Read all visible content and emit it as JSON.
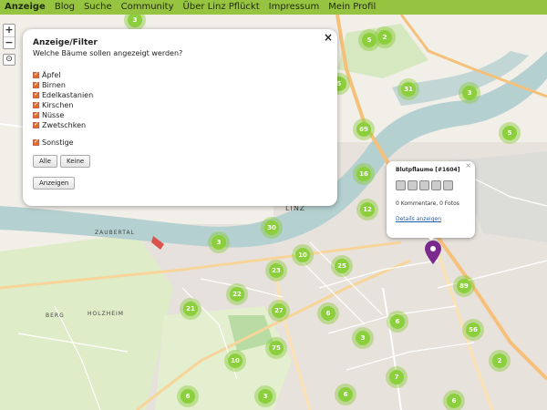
{
  "nav": {
    "items": [
      "Anzeige",
      "Blog",
      "Suche",
      "Community",
      "Über Linz Pflückt",
      "Impressum",
      "Mein Profil"
    ]
  },
  "map": {
    "labels": {
      "zaubertal": "ZAUBERTAL",
      "holzheim": "HOLZHEIM",
      "berg": "BERG",
      "linz": "LINZ"
    },
    "clusters": [
      "3",
      "5",
      "31",
      "69",
      "16",
      "12",
      "30",
      "3",
      "10",
      "25",
      "23",
      "22",
      "21",
      "27",
      "75",
      "10",
      "6",
      "6",
      "6",
      "3",
      "7",
      "3",
      "89",
      "56",
      "2",
      "6",
      "6",
      "2",
      "3",
      "5",
      "5"
    ]
  },
  "controls": {
    "zoom_in": "+",
    "zoom_out": "−",
    "locate_icon": "crosshair-icon"
  },
  "filter": {
    "close": "×",
    "title": "Anzeige/Filter",
    "question": "Welche Bäume sollen angezeigt werden?",
    "options": [
      "Äpfel",
      "Birnen",
      "Edelkastanien",
      "Kirschen",
      "Nüsse",
      "Zwetschken"
    ],
    "other": "Sonstige",
    "all_button": "Alle",
    "none_button": "Keine",
    "show_button": "Anzeigen"
  },
  "popup": {
    "close": "×",
    "title": "Blutpflaume [#1604]",
    "info": "0 Kommentare, 0 Fotos",
    "link": "Details anzeigen"
  },
  "colors": {
    "nav_bg": "#97c440",
    "cluster": "#8ccf3c",
    "water": "#b5d0d0",
    "checkbox": "#e96b1b"
  }
}
